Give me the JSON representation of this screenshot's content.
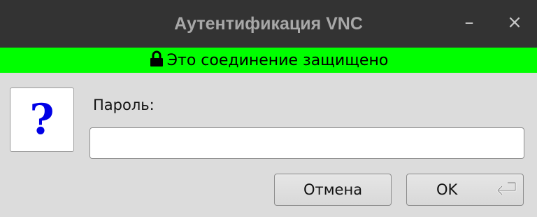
{
  "window": {
    "title": "Аутентификация VNC",
    "minimize_glyph": "–",
    "close_glyph": "×"
  },
  "banner": {
    "text": "Это соединение защищено",
    "icon": "lock-icon",
    "color": "#00ff00"
  },
  "prompt": {
    "icon_glyph": "?",
    "icon": "question-icon",
    "label": "Пароль:",
    "input_value": ""
  },
  "buttons": {
    "cancel_label": "Отмена",
    "ok_label": "OK",
    "ok_icon": "enter-key-icon"
  }
}
